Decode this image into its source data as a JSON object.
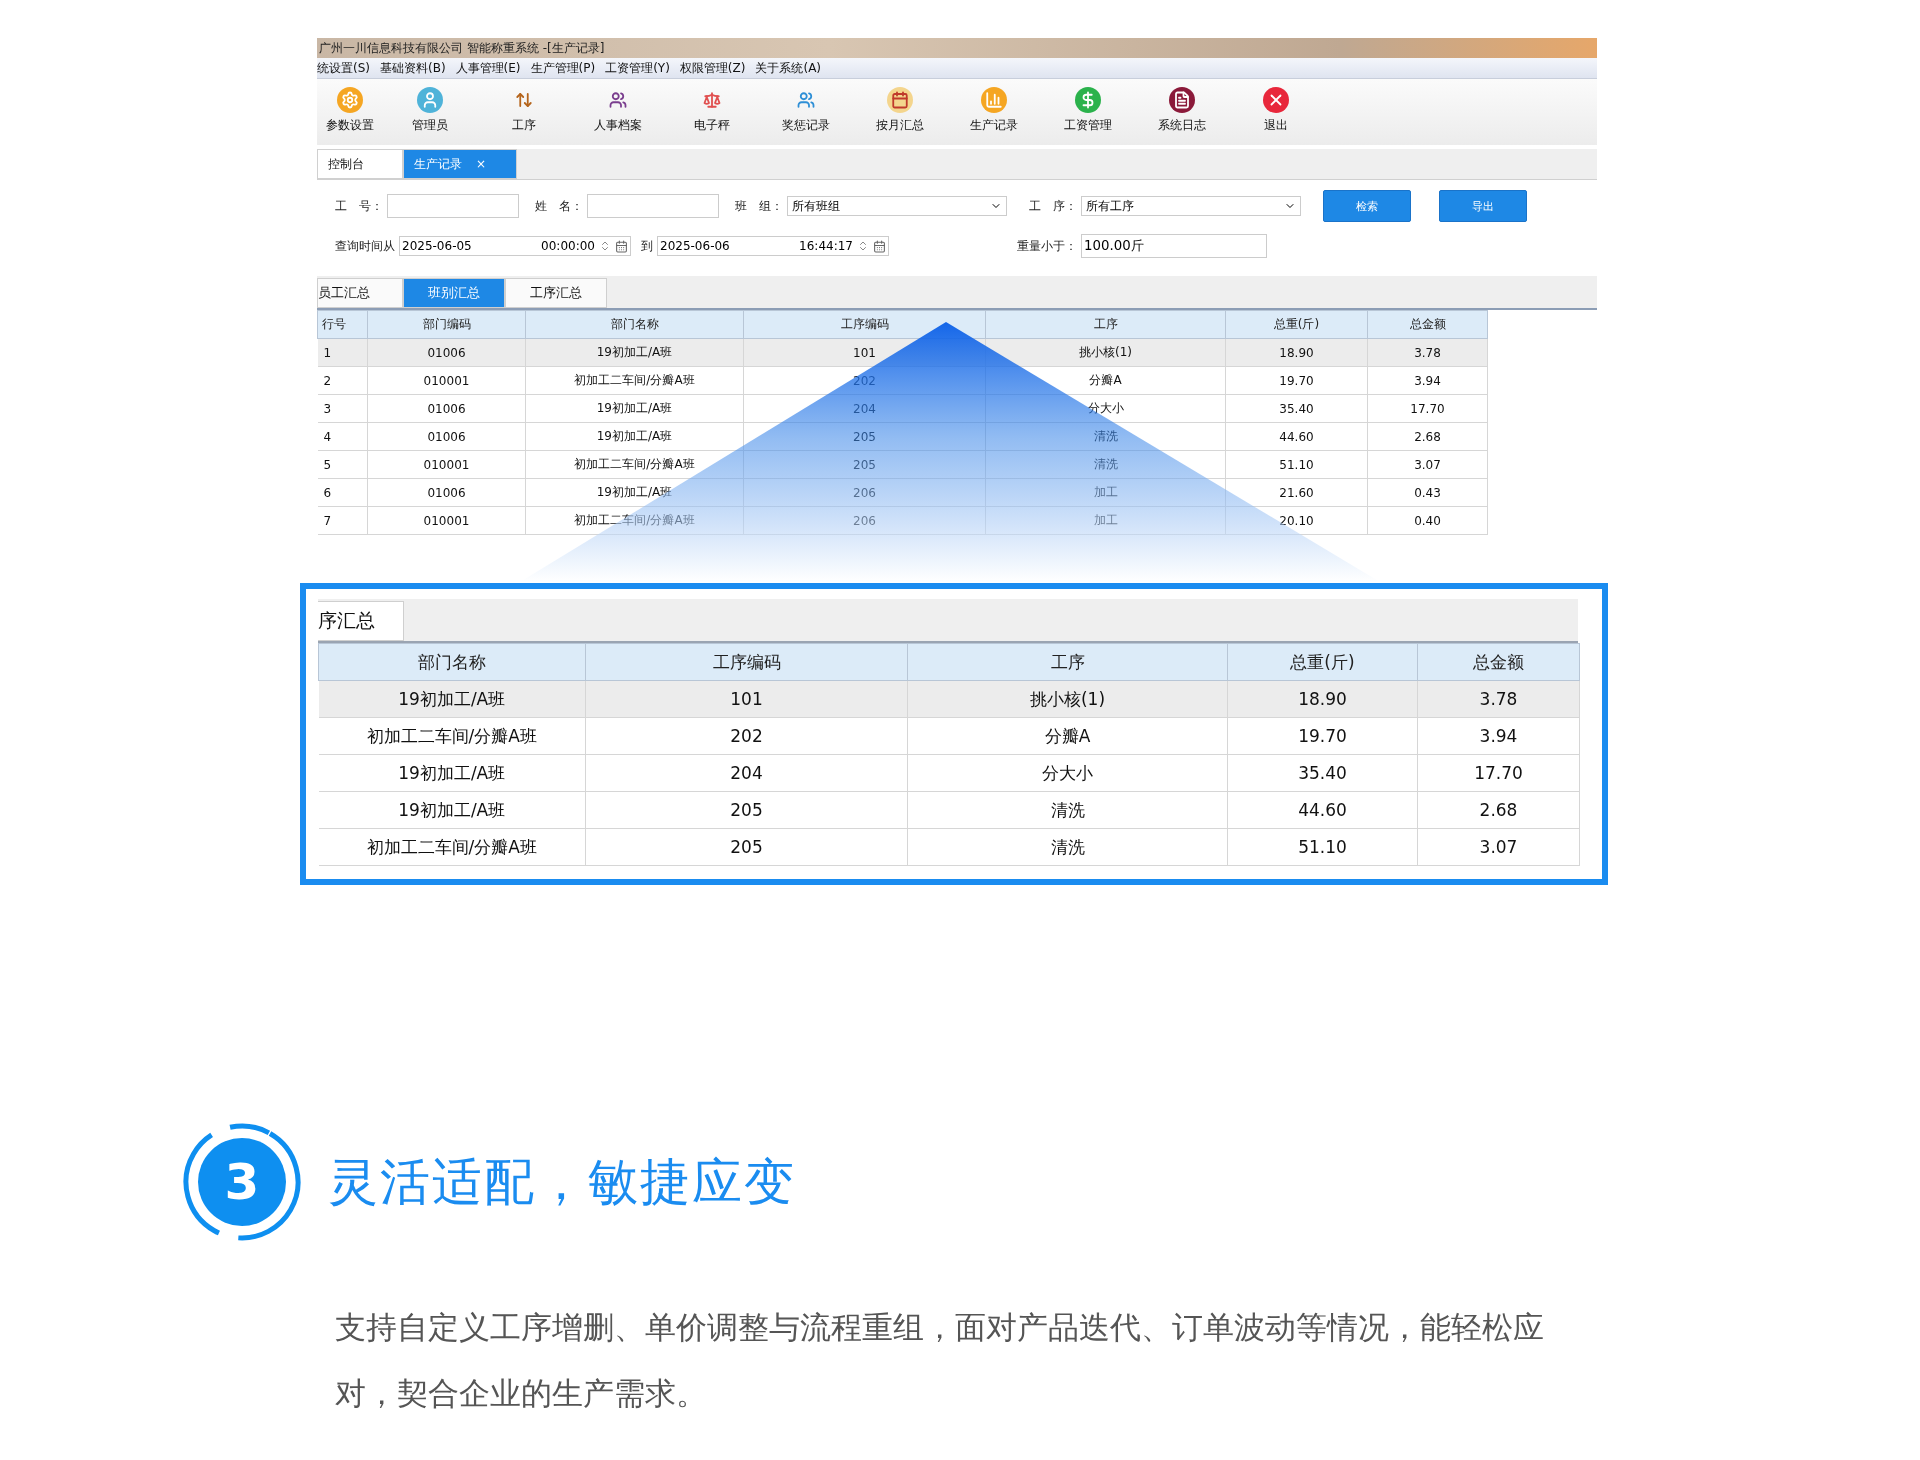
{
  "window": {
    "title": "广州一川信息科技有限公司 智能称重系统 -[生产记录]"
  },
  "menu": [
    "统设置(S)",
    "基础资料(B)",
    "人事管理(E)",
    "生产管理(P)",
    "工资管理(Y)",
    "权限管理(Z)",
    "关于系统(A)"
  ],
  "toolbar": [
    {
      "label": "参数设置",
      "kind": "settings"
    },
    {
      "label": "管理员",
      "kind": "admin"
    },
    {
      "label": "工序",
      "kind": "process"
    },
    {
      "label": "人事档案",
      "kind": "staff"
    },
    {
      "label": "电子秤",
      "kind": "scale"
    },
    {
      "label": "奖惩记录",
      "kind": "awards"
    },
    {
      "label": "按月汇总",
      "kind": "calendar"
    },
    {
      "label": "生产记录",
      "kind": "production"
    },
    {
      "label": "工资管理",
      "kind": "salary"
    },
    {
      "label": "系统日志",
      "kind": "log"
    },
    {
      "label": "退出",
      "kind": "exit"
    }
  ],
  "doc_tabs": [
    {
      "label": "控制台",
      "selected": false
    },
    {
      "label": "生产记录",
      "selected": true,
      "close": "×"
    }
  ],
  "filters": {
    "fields": [
      {
        "kind": "input",
        "label": "工　号："
      },
      {
        "kind": "input",
        "label": "姓　名："
      },
      {
        "kind": "select",
        "label": "班　组：",
        "value": "所有班组"
      },
      {
        "kind": "select",
        "label": "工　序：",
        "value": "所有工序"
      }
    ],
    "buttons": [
      "检索",
      "导出"
    ],
    "time_from_label": "查询时间从",
    "from_date": "2025-06-05",
    "from_time": "00:00:00",
    "to_label": "到",
    "to_date": "2025-06-06",
    "to_time": "16:44:17",
    "weight_label": "重量小于：",
    "weight_value": "100.00斤"
  },
  "summary_tabs": [
    {
      "label": "员工汇总",
      "selected": false
    },
    {
      "label": "班别汇总",
      "selected": true
    },
    {
      "label": "工序汇总",
      "selected": false
    }
  ],
  "table": {
    "columns": [
      "行号",
      "部门编码",
      "部门名称",
      "工序编码",
      "工序",
      "总重(斤)",
      "总金额"
    ],
    "rows": [
      {
        "selected": true,
        "cells": [
          "1",
          "01006",
          "19初加工/A班",
          "101",
          "挑小核(1)",
          "18.90",
          "3.78"
        ]
      },
      {
        "selected": false,
        "cells": [
          "2",
          "010001",
          "初加工二车间/分瓣A班",
          "202",
          "分瓣A",
          "19.70",
          "3.94"
        ]
      },
      {
        "selected": false,
        "cells": [
          "3",
          "01006",
          "19初加工/A班",
          "204",
          "分大小",
          "35.40",
          "17.70"
        ]
      },
      {
        "selected": false,
        "cells": [
          "4",
          "01006",
          "19初加工/A班",
          "205",
          "清洗",
          "44.60",
          "2.68"
        ]
      },
      {
        "selected": false,
        "cells": [
          "5",
          "010001",
          "初加工二车间/分瓣A班",
          "205",
          "清洗",
          "51.10",
          "3.07"
        ]
      },
      {
        "selected": false,
        "cells": [
          "6",
          "01006",
          "19初加工/A班",
          "206",
          "加工",
          "21.60",
          "0.43"
        ]
      },
      {
        "selected": false,
        "cells": [
          "7",
          "010001",
          "初加工二车间/分瓣A班",
          "206",
          "加工",
          "20.10",
          "0.40"
        ]
      }
    ]
  },
  "zoom_panel": {
    "tab": "序汇总",
    "columns": [
      "部门名称",
      "工序编码",
      "工序",
      "总重(斤)",
      "总金额"
    ],
    "rows": [
      {
        "selected": true,
        "cells": [
          "19初加工/A班",
          "101",
          "挑小核(1)",
          "18.90",
          "3.78"
        ]
      },
      {
        "selected": false,
        "cells": [
          "初加工二车间/分瓣A班",
          "202",
          "分瓣A",
          "19.70",
          "3.94"
        ]
      },
      {
        "selected": false,
        "cells": [
          "19初加工/A班",
          "204",
          "分大小",
          "35.40",
          "17.70"
        ]
      },
      {
        "selected": false,
        "cells": [
          "19初加工/A班",
          "205",
          "清洗",
          "44.60",
          "2.68"
        ]
      },
      {
        "selected": false,
        "cells": [
          "初加工二车间/分瓣A班",
          "205",
          "清洗",
          "51.10",
          "3.07"
        ]
      }
    ]
  },
  "feature": {
    "number": "3",
    "title": "灵活适配，敏捷应变",
    "description": "支持自定义工序增删、单价调整与流程重组，面对产品迭代、订单波动等情况，能轻松应对，契合企业的生产需求。"
  }
}
